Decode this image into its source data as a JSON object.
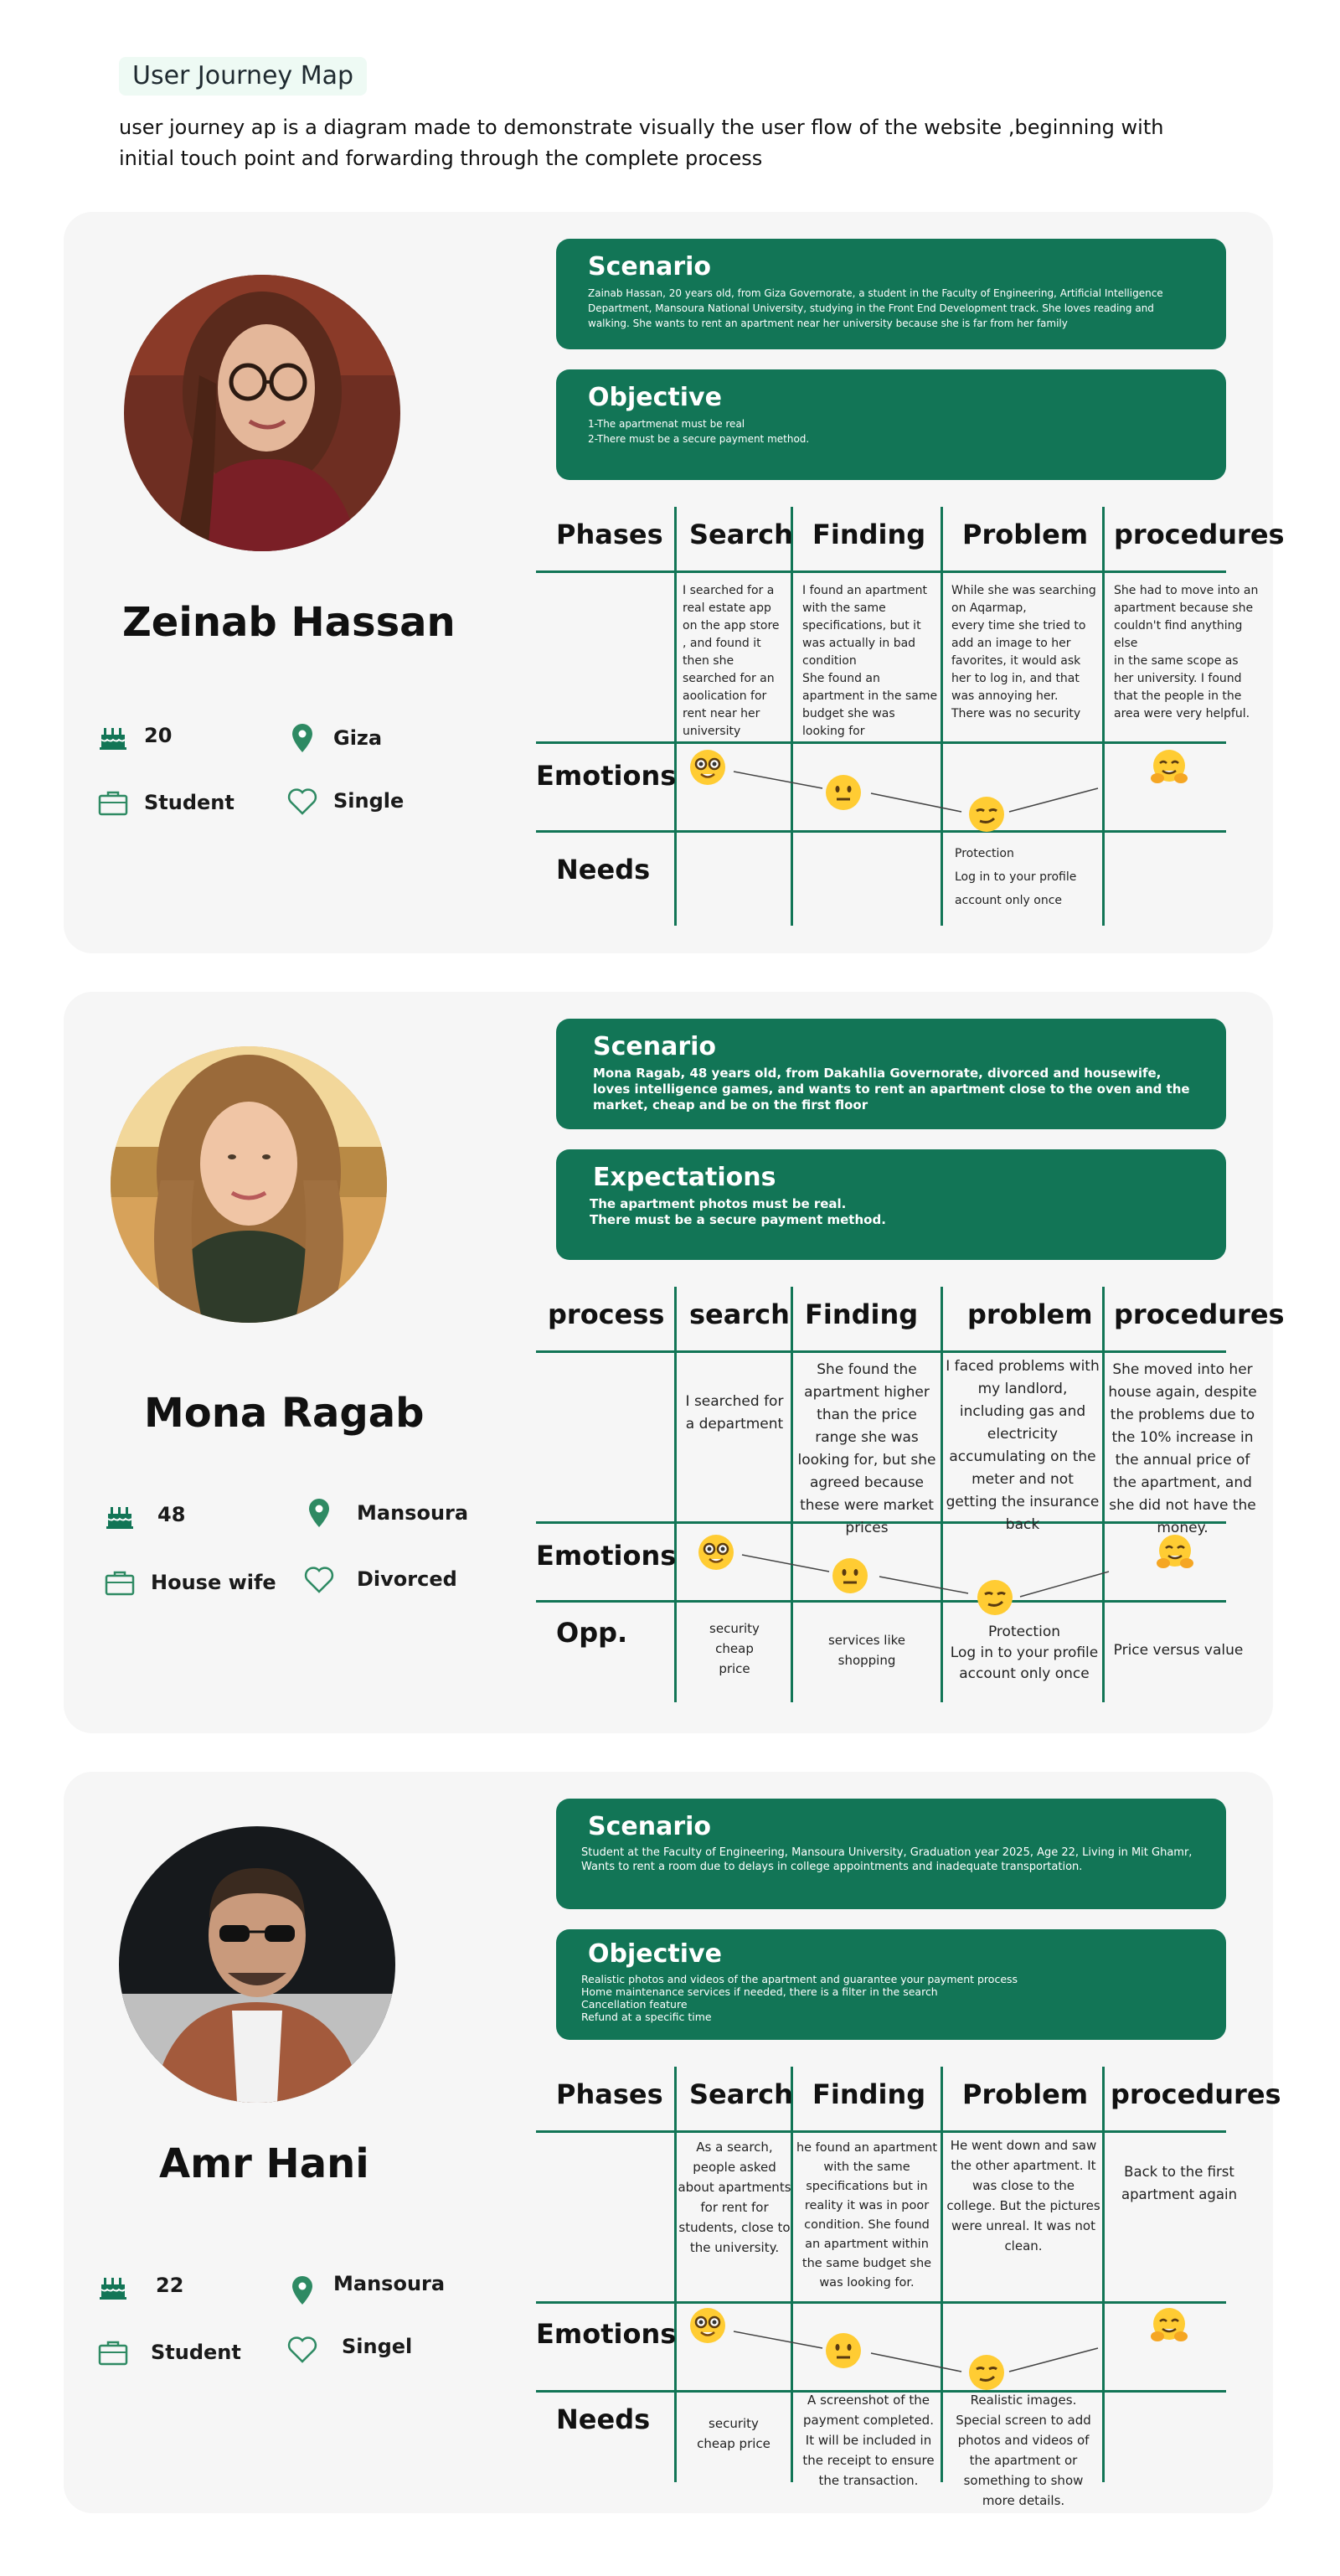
{
  "header": {
    "title": "User Journey Map",
    "description": "user journey ap is a diagram made to demonstrate visually the user flow of the website ,beginning with initial touch point and forwarding through the complete process"
  },
  "personas": [
    {
      "name": "Zeinab Hassan",
      "age": "20",
      "city": "Giza",
      "job": "Student",
      "status": "Single",
      "scenario_title": "Scenario",
      "scenario_text": "Zainab Hassan, 20 years old, from Giza Governorate, a student in the Faculty of Engineering, Artificial Intelligence Department, Mansoura National University, studying in the Front End Development track. She loves reading and walking. She wants to rent an apartment near her university because she is far from her family",
      "objective_title": "Objective",
      "objective_text": "1-The apartmenat must be real\n 2-There must be a secure payment method.",
      "columns": [
        "Phases",
        "Search",
        "Finding",
        "Problem",
        "procedures"
      ],
      "cells": [
        "I searched for a real estate app on the app store\n , and found it then she searched for an aoolication for rent near her university",
        "I found an apartment with the same specifications, but it was actually in bad condition\nShe found an apartment in the same budget she was looking for",
        "While she was searching on Aqarmap,\nevery time she tried to add an image to her favorites, it would ask her to log in, and that was annoying her.\nThere was no security",
        "She had to move into an apartment because she couldn't find anything else\n in the same scope as her university. I found that the people in the area were very helpful."
      ],
      "emotions_label": "Emotions",
      "needs_label": "Needs",
      "needs": [
        "",
        "",
        "Protection\nLog in to your profile account only once",
        ""
      ]
    },
    {
      "name": "Mona Ragab",
      "age": "48",
      "city": "Mansoura",
      "job": "House wife",
      "status": "Divorced",
      "scenario_title": "Scenario",
      "scenario_text": "Mona Ragab, 48 years old, from Dakahlia Governorate, divorced and housewife, loves intelligence games, and wants to rent an apartment close to the oven and the market, cheap and be on the first floor",
      "objective_title": "Expectations",
      "objective_text": " The apartment photos must be real.\nThere must be a secure payment method.",
      "columns": [
        "process",
        "search",
        "Finding",
        "problem",
        "procedures"
      ],
      "cells": [
        "I searched for a department",
        "She found the apartment higher than the price range she was looking for, but she agreed because these were market prices",
        "I faced problems with my landlord, including gas and electricity accumulating on the meter and not getting the insurance back",
        "She moved into her house again, despite the problems due to the 10% increase in the annual price of the apartment, and she did not have the money."
      ],
      "emotions_label": "Emotions",
      "needs_label": "Opp.",
      "needs": [
        "security\ncheap\nprice",
        "services like shopping",
        "Protection\nLog in to your profile account only once",
        "Price versus value"
      ]
    },
    {
      "name": "Amr Hani",
      "age": "22",
      "city": "Mansoura",
      "job": "Student",
      "status": "Singel",
      "scenario_title": "Scenario",
      "scenario_text": "Student at the Faculty of Engineering, Mansoura University, Graduation year 2025, Age 22, Living in Mit Ghamr, Wants to rent a room due to delays in college appointments and inadequate transportation.",
      "objective_title": "Objective",
      "objective_text": "Realistic photos and videos of the apartment and guarantee your payment process\nHome maintenance services if needed, there is a filter in the search\nCancellation feature\nRefund at a specific time",
      "columns": [
        "Phases",
        "Search",
        "Finding",
        "Problem",
        "procedures"
      ],
      "cells": [
        "As a search, people asked about apartments for rent for students, close to the university.",
        "he found an apartment with the same specifications but in reality it was in poor condition. She found an apartment within the same budget she was looking for.",
        "He went down and saw the other apartment. It was close to the college. But the pictures were unreal. It was not clean.",
        "Back to the first apartment again"
      ],
      "emotions_label": "Emotions",
      "needs_label": "Needs",
      "needs": [
        "security\ncheap price",
        "A screenshot of the payment completed. It will be included in the receipt to ensure the transaction.",
        "Realistic images. Special screen to add photos and videos of the apartment or something to show more details.",
        ""
      ]
    }
  ],
  "emotions": [
    "nerd-face",
    "neutral-face",
    "smirking-face",
    "hugging-face"
  ],
  "colors": {
    "accent": "#127556",
    "card_bg": "#f6f6f6",
    "title_bg": "#eefaf4"
  }
}
